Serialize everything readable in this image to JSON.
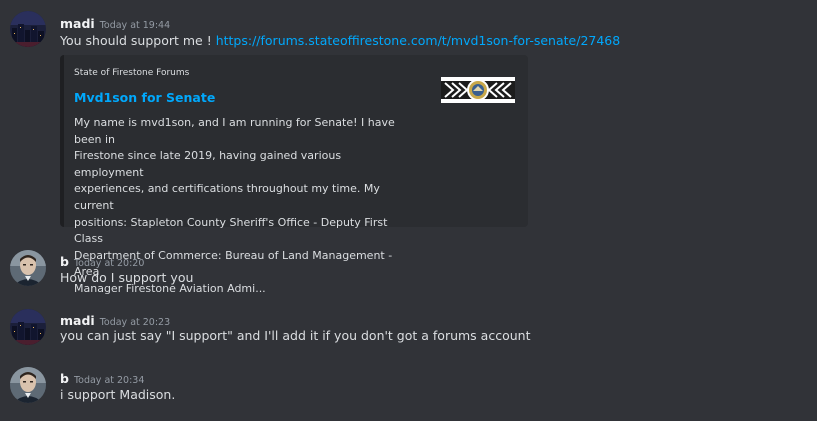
{
  "messages": [
    {
      "username": "madi",
      "timestamp": "Today at 19:44",
      "text": "You should support me ! ",
      "link": "https://forums.stateoffirestone.com/t/mvd1son-for-senate/27468",
      "avatar_icon": "night-city-avatar",
      "embed": {
        "provider": "State of Firestone Forums",
        "title": "Mvd1son for Senate",
        "description_lines": [
          "My name is mvd1son, and I am running for Senate! I have been in",
          "Firestone since late 2019, having gained various employment",
          "experiences, and certifications throughout my time. My current",
          "positions: Stapleton County Sheriff's Office - Deputy First Class",
          "Department of Commerce: Bureau of Land Management - Area",
          "Manager Firestone Aviation Admi..."
        ],
        "thumbnail_icon": "firestone-seal-banner-icon"
      }
    },
    {
      "username": "b",
      "timestamp": "Today at 20:20",
      "text": "How do I support you",
      "avatar_icon": "portrait-avatar"
    },
    {
      "username": "madi",
      "timestamp": "Today at 20:23",
      "text": "you can just say \"I support\" and I'll add it if you don't got a forums account",
      "avatar_icon": "night-city-avatar"
    },
    {
      "username": "b",
      "timestamp": "Today at 20:34",
      "text": "i support Madison.",
      "avatar_icon": "portrait-avatar"
    }
  ],
  "colors": {
    "background": "#313338",
    "username": "#f2f3f5",
    "timestamp": "#949ba4",
    "text": "#dbdee1",
    "link": "#00a8fc",
    "embed_background": "#2b2d31",
    "embed_border": "#1e1f22"
  }
}
